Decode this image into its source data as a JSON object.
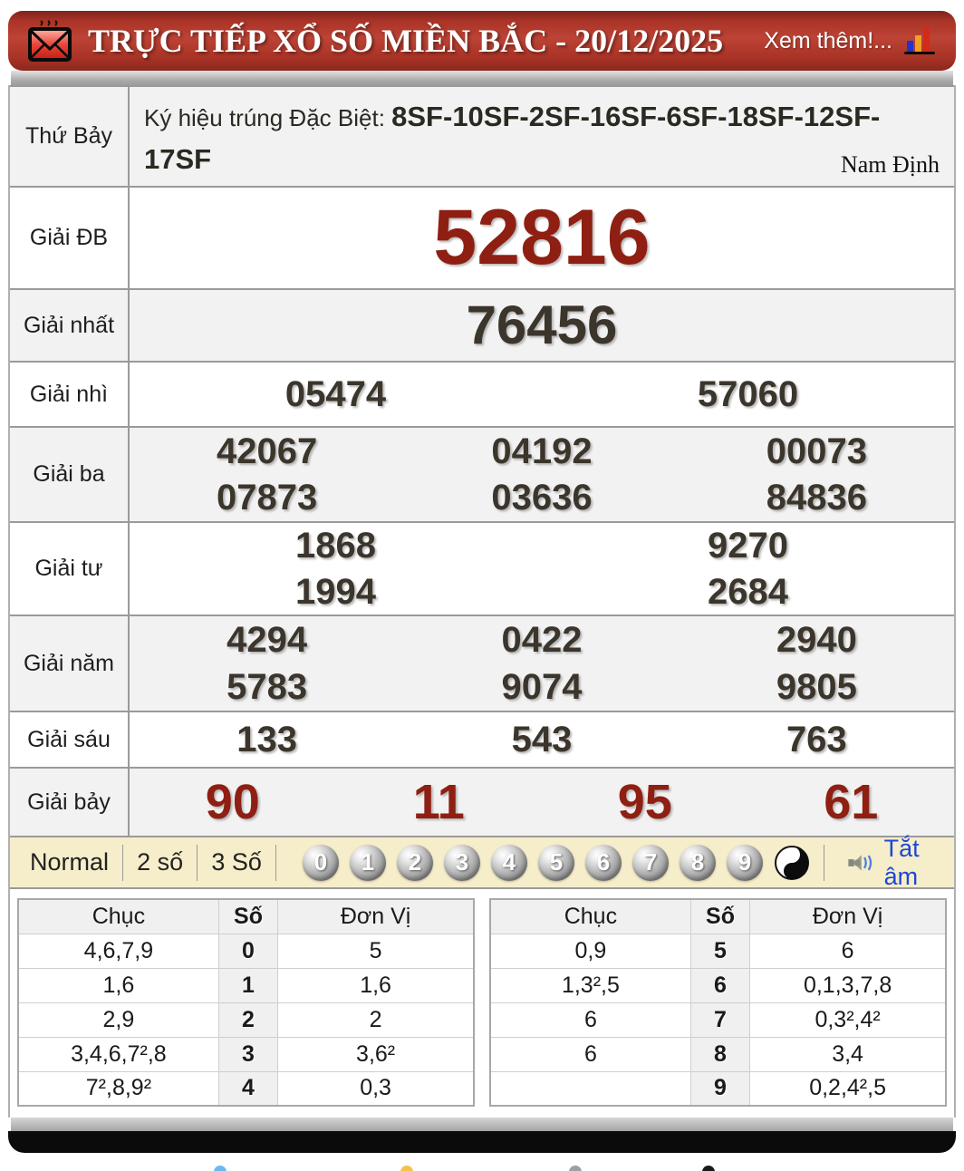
{
  "header": {
    "title": "TRỰC TIẾP XỔ SỐ MIỀN BẮC - 20/12/2025",
    "more_label": "Xem thêm!...",
    "icons": {
      "left": "hot-envelope-icon",
      "right": "bar-chart-icon"
    }
  },
  "results": {
    "day_label": "Thứ Bảy",
    "symbol_prefix": "Ký hiệu trúng Đặc Biệt: ",
    "symbol_code": "8SF-10SF-2SF-16SF-6SF-18SF-12SF-17SF",
    "province": "Nam Định",
    "prizes": [
      {
        "label": "Giải ĐB",
        "rows": [
          [
            "52816"
          ]
        ]
      },
      {
        "label": "Giải nhất",
        "rows": [
          [
            "76456"
          ]
        ]
      },
      {
        "label": "Giải nhì",
        "rows": [
          [
            "05474",
            "57060"
          ]
        ]
      },
      {
        "label": "Giải ba",
        "rows": [
          [
            "42067",
            "04192",
            "00073"
          ],
          [
            "07873",
            "03636",
            "84836"
          ]
        ]
      },
      {
        "label": "Giải tư",
        "rows": [
          [
            "1868",
            "9270"
          ],
          [
            "1994",
            "2684"
          ]
        ]
      },
      {
        "label": "Giải năm",
        "rows": [
          [
            "4294",
            "0422",
            "2940"
          ],
          [
            "5783",
            "9074",
            "9805"
          ]
        ]
      },
      {
        "label": "Giải sáu",
        "rows": [
          [
            "133",
            "543",
            "763"
          ]
        ]
      },
      {
        "label": "Giải bảy",
        "rows": [
          [
            "90",
            "11",
            "95",
            "61"
          ]
        ]
      }
    ]
  },
  "controls": {
    "modes": [
      "Normal",
      "2 số",
      "3 Số"
    ],
    "digits": [
      "0",
      "1",
      "2",
      "3",
      "4",
      "5",
      "6",
      "7",
      "8",
      "9"
    ],
    "yinyang_icon": "yin-yang-icon",
    "speaker_icon": "speaker-icon",
    "mute_label": "Tắt âm"
  },
  "stats": {
    "headers": {
      "tens": "Chục",
      "digit": "Số",
      "units": "Đơn Vị"
    },
    "left": [
      {
        "tens": "4,6,7,9",
        "digit": "0",
        "units": "5"
      },
      {
        "tens": "1,6",
        "digit": "1",
        "units": "1,6"
      },
      {
        "tens": "2,9",
        "digit": "2",
        "units": "2"
      },
      {
        "tens": "3,4,6,7²,8",
        "digit": "3",
        "units": "3,6²"
      },
      {
        "tens": "7²,8,9²",
        "digit": "4",
        "units": "0,3"
      }
    ],
    "right": [
      {
        "tens": "0,9",
        "digit": "5",
        "units": "6"
      },
      {
        "tens": "1,3²,5",
        "digit": "6",
        "units": "0,1,3,7,8"
      },
      {
        "tens": "6",
        "digit": "7",
        "units": "0,3²,4²"
      },
      {
        "tens": "6",
        "digit": "8",
        "units": "3,4"
      },
      {
        "tens": "",
        "digit": "9",
        "units": "0,2,4²,5"
      }
    ]
  },
  "colors": {
    "header_red": "#b03a2e",
    "number_dark": "#3b352c",
    "number_red": "#8e1f12",
    "controls_bg": "#f6edca",
    "mute_blue": "#1d48d8"
  }
}
